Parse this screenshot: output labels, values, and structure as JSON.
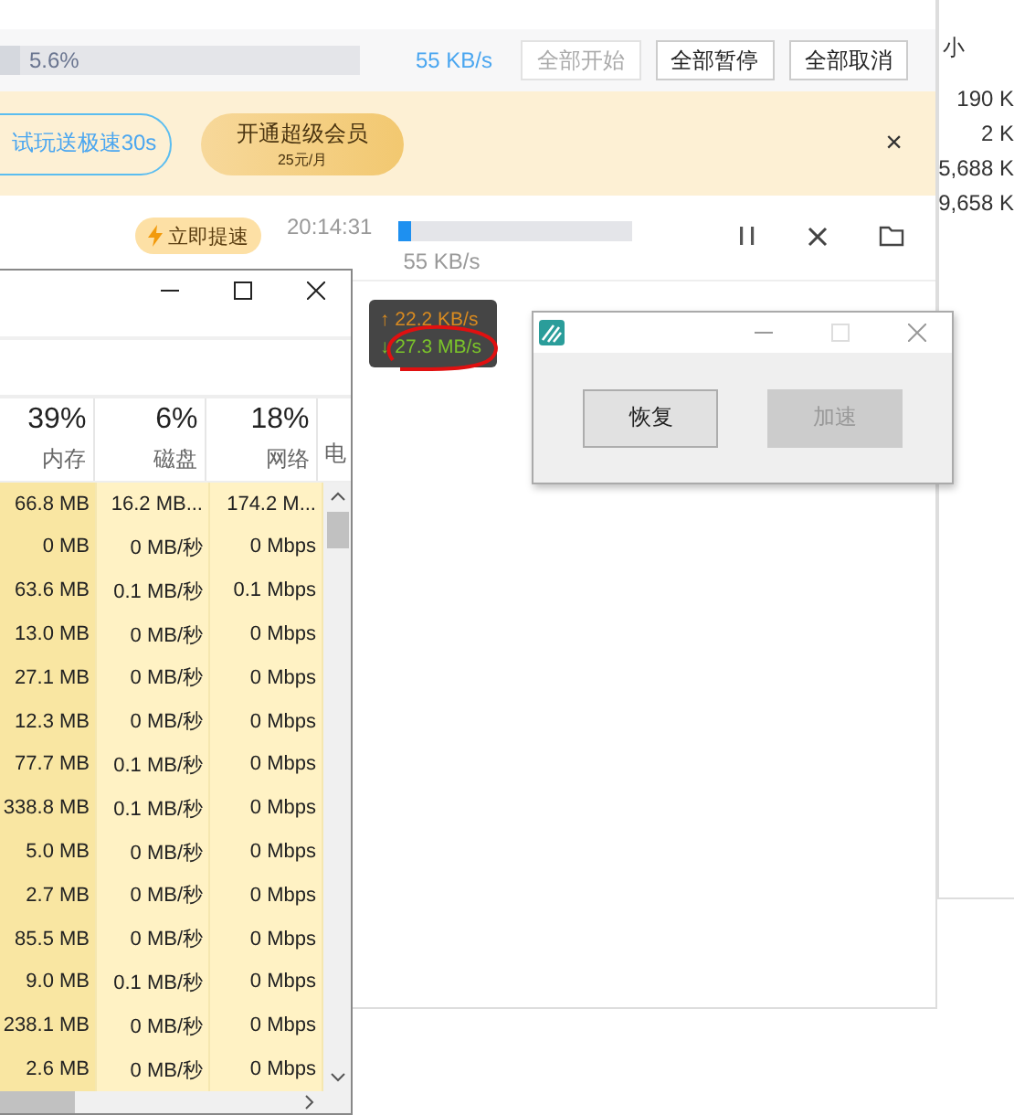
{
  "download_window": {
    "toolbar": {
      "progress": {
        "level": 0.056,
        "label": "5.6%"
      },
      "speed": "55 KB/s",
      "buttons": [
        {
          "label": "全部开始",
          "disabled": true
        },
        {
          "label": "全部暂停",
          "disabled": false
        },
        {
          "label": "全部取消",
          "disabled": false
        }
      ]
    },
    "promo": {
      "trial_button": "试玩送极速30s",
      "vip_button": {
        "label": "开通超级会员",
        "price": "25元/月"
      },
      "close": "×"
    },
    "task": {
      "boost_button": "立即提速",
      "time": "20:14:31",
      "progress": {
        "level": 0.06
      },
      "speed": "55 KB/s"
    }
  },
  "speed_widget": {
    "upload": "↑ 22.2 KB/s",
    "download": "↓ 27.3 MB/s"
  },
  "dialog": {
    "buttons": [
      {
        "label": "恢复",
        "disabled": false
      },
      {
        "label": "加速",
        "disabled": true
      }
    ]
  },
  "task_manager": {
    "columns": [
      {
        "percent": "39%",
        "label": "内存"
      },
      {
        "percent": "6%",
        "label": "磁盘"
      },
      {
        "percent": "18%",
        "label": "网络"
      },
      {
        "label": "电"
      }
    ],
    "rows": [
      [
        "66.8 MB",
        "16.2 MB...",
        "174.2 M..."
      ],
      [
        "0 MB",
        "0 MB/秒",
        "0 Mbps"
      ],
      [
        "63.6 MB",
        "0.1 MB/秒",
        "0.1 Mbps"
      ],
      [
        "13.0 MB",
        "0 MB/秒",
        "0 Mbps"
      ],
      [
        "27.1 MB",
        "0 MB/秒",
        "0 Mbps"
      ],
      [
        "12.3 MB",
        "0 MB/秒",
        "0 Mbps"
      ],
      [
        "77.7 MB",
        "0.1 MB/秒",
        "0 Mbps"
      ],
      [
        "338.8 MB",
        "0.1 MB/秒",
        "0 Mbps"
      ],
      [
        "5.0 MB",
        "0 MB/秒",
        "0 Mbps"
      ],
      [
        "2.7 MB",
        "0 MB/秒",
        "0 Mbps"
      ],
      [
        "85.5 MB",
        "0 MB/秒",
        "0 Mbps"
      ],
      [
        "9.0 MB",
        "0.1 MB/秒",
        "0 Mbps"
      ],
      [
        "238.1 MB",
        "0 MB/秒",
        "0 Mbps"
      ],
      [
        "2.6 MB",
        "0 MB/秒",
        "0 Mbps"
      ]
    ]
  },
  "explorer": {
    "column_header": "小",
    "sizes": [
      "190 K",
      "2 K",
      "5,688 K",
      "9,658 K"
    ]
  }
}
